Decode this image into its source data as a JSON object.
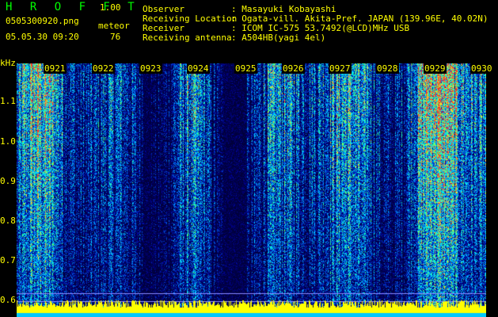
{
  "app": {
    "title": "H R O F F T",
    "version": "1.00"
  },
  "file": {
    "name": "0505300920.png",
    "datetime": "05.05.30 09:20"
  },
  "meteor": {
    "label": "meteor",
    "count": "76"
  },
  "station": {
    "observer_label": "Observer",
    "observer_value": ": Masayuki Kobayashi",
    "location_label": "Receiving Location",
    "location_value": ": Ogata-vill. Akita-Pref. JAPAN (139.96E, 40.02N)",
    "receiver_label": "Receiver",
    "receiver_value": ": ICOM IC-575 53.7492(@LCD)MHz USB",
    "antenna_label": "Receiving antenna",
    "antenna_value": ": A504HB(yagi 4el)"
  },
  "axis": {
    "y_unit": "kHz",
    "y_ticks": [
      "1.1",
      "1.0",
      "0.9",
      "0.8",
      "0.7",
      "0.6"
    ],
    "x_ticks": [
      "0921",
      "0922",
      "0923",
      "0924",
      "0925",
      "0926",
      "0927",
      "0928",
      "0929",
      "0930"
    ]
  },
  "colors": {
    "background": "#000000",
    "label": "#ffff00",
    "title": "#00ff00",
    "spectrum_low": "#000066",
    "spectrum_high": "#ff2020"
  }
}
